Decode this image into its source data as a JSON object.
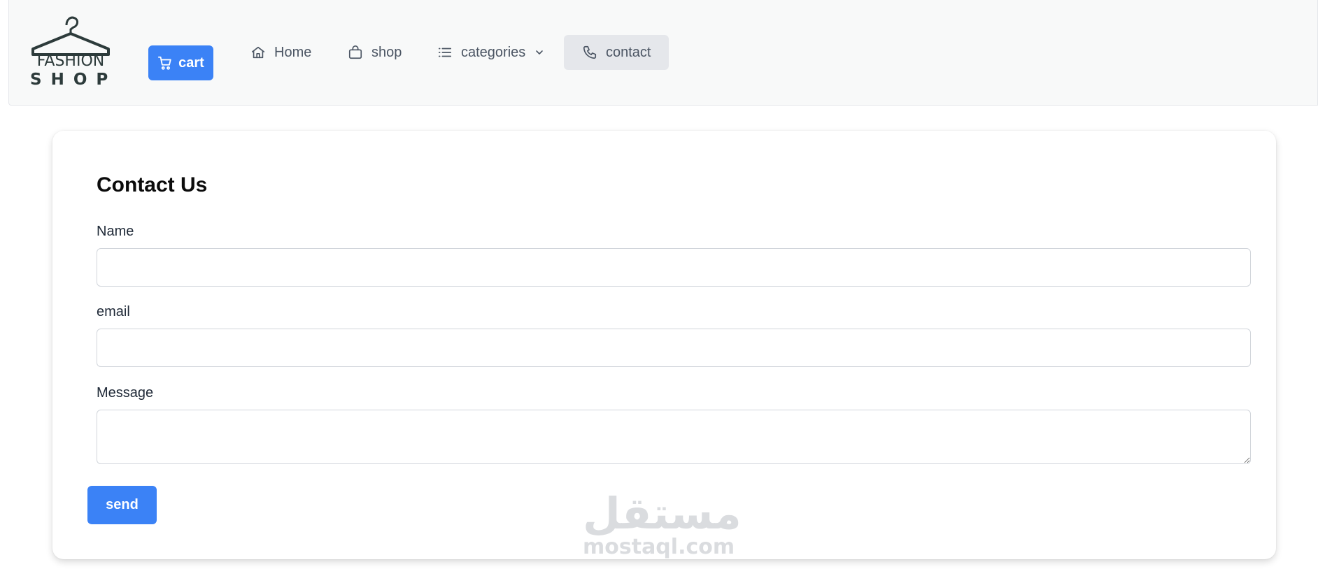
{
  "logo": {
    "line1": "FASHION",
    "line2": "SHOP"
  },
  "nav": {
    "cart_label": "cart",
    "home_label": "Home",
    "shop_label": "shop",
    "categories_label": "categories",
    "contact_label": "contact"
  },
  "contact_form": {
    "title": "Contact Us",
    "name_label": "Name",
    "name_value": "",
    "email_label": "email",
    "email_value": "",
    "message_label": "Message",
    "message_value": "",
    "send_label": "send"
  },
  "watermark": {
    "arabic": "مستقل",
    "latin": "mostaql.com"
  },
  "colors": {
    "accent": "#3b82f6",
    "nav_background": "#f8f9f9",
    "active_nav": "#e5e7eb",
    "logo": "#2d3b3b"
  },
  "icons": {
    "cart": "shopping-cart-icon",
    "home": "home-icon",
    "shop": "shopping-bag-icon",
    "categories": "list-icon",
    "dropdown": "chevron-down-icon",
    "contact": "phone-icon"
  }
}
